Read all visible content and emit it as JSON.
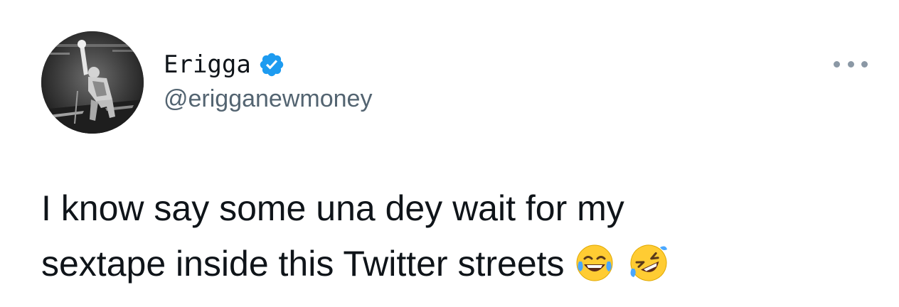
{
  "author": {
    "display_name": "Erigga",
    "handle": "@erigganewmoney",
    "verified_icon": "verified-badge-icon",
    "avatar_icon": "profile-photo"
  },
  "tweet": {
    "line1": "I know say some una dey wait for my",
    "line2": "sextape inside this Twitter streets",
    "emojis": [
      "face-with-tears-of-joy",
      "rolling-on-the-floor-laughing"
    ]
  },
  "menu": {
    "icon": "more-options-icon"
  },
  "colors": {
    "text": "#0f1419",
    "secondary": "#536471",
    "verified": "#1d9bf0",
    "more_dots": "#8b98a5"
  }
}
